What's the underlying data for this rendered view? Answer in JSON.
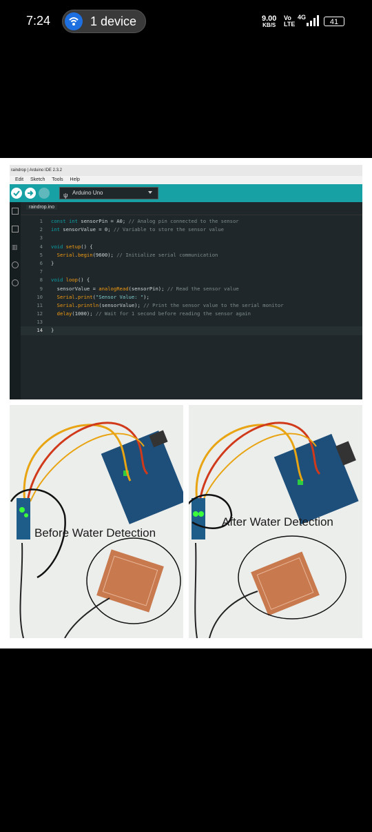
{
  "status_bar": {
    "time": "7:24",
    "device_label": "1 device",
    "speed_value": "9.00",
    "speed_unit": "KB/S",
    "volte": "Vo",
    "lte": "LTE",
    "network": "4G",
    "battery": "41"
  },
  "ide": {
    "title": "raindrop | Arduino IDE 2.3.2",
    "menu": [
      "Edit",
      "Sketch",
      "Tools",
      "Help"
    ],
    "board": "Arduino Uno",
    "tab": "raindrop.ino",
    "line_numbers": [
      "1",
      "2",
      "3",
      "4",
      "5",
      "6",
      "7",
      "8",
      "9",
      "10",
      "11",
      "12",
      "13",
      "14"
    ]
  },
  "captions": {
    "before": "Before Water Detection",
    "after": "After Water Detection"
  },
  "colors": {
    "ide_teal": "#17a1a5",
    "ide_bg": "#1f272a",
    "keyword": "#0ca1a6",
    "function": "#f39c12"
  }
}
